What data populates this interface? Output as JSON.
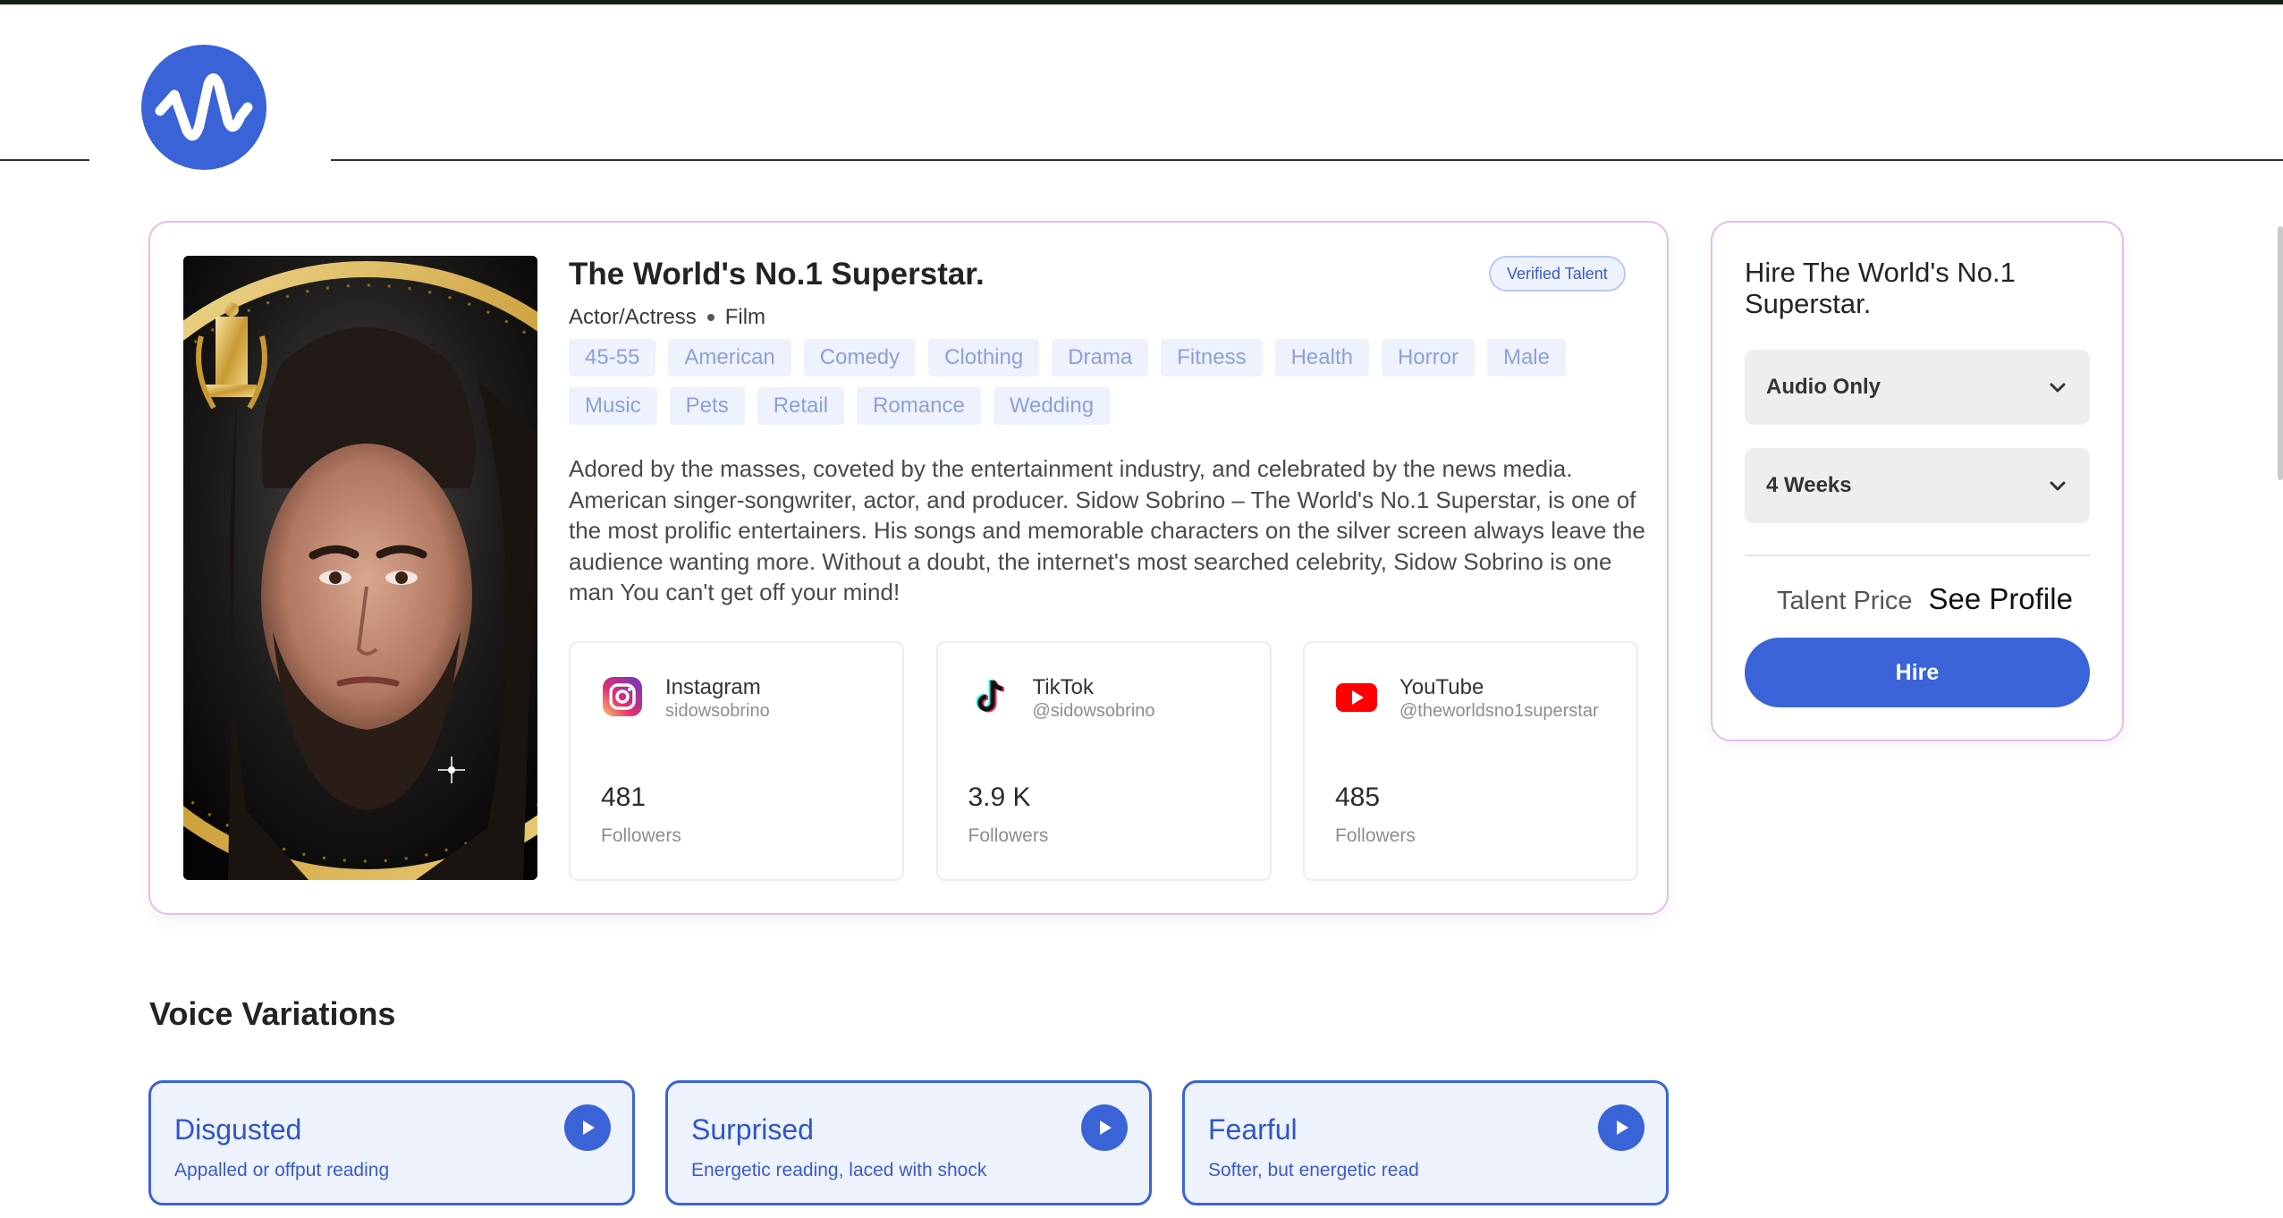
{
  "profile": {
    "title": "The World's No.1 Superstar.",
    "verified_badge": "Verified Talent",
    "role": "Actor/Actress",
    "category": "Film",
    "tags": [
      "45-55",
      "American",
      "Comedy",
      "Clothing",
      "Drama",
      "Fitness",
      "Health",
      "Horror",
      "Male",
      "Music",
      "Pets",
      "Retail",
      "Romance",
      "Wedding"
    ],
    "bio": "Adored by the masses, coveted by the entertainment industry, and celebrated by the news media. American singer-songwriter, actor, and producer. Sidow Sobrino – The World's No.1 Superstar, is one of the most prolific entertainers. His songs and memorable characters on the silver screen always leave the audience wanting more. Without a doubt, the internet's most searched celebrity, Sidow Sobrino is one man You can't get off your mind!"
  },
  "social": [
    {
      "platform": "Instagram",
      "handle": "sidowsobrino",
      "count": "481",
      "label": "Followers",
      "icon": "instagram-icon"
    },
    {
      "platform": "TikTok",
      "handle": "@sidowsobrino",
      "count": "3.9 K",
      "label": "Followers",
      "icon": "tiktok-icon"
    },
    {
      "platform": "YouTube",
      "handle": "@theworldsno1superstar",
      "count": "485",
      "label": "Followers",
      "icon": "youtube-icon"
    }
  ],
  "hire": {
    "title": "Hire The World's No.1 Superstar.",
    "usage_select": "Audio Only",
    "duration_select": "4 Weeks",
    "price_label": "Talent Price",
    "price_link": "See Profile",
    "button": "Hire"
  },
  "voice": {
    "section_title": "Voice Variations",
    "items": [
      {
        "name": "Disgusted",
        "desc": "Appalled or offput reading"
      },
      {
        "name": "Surprised",
        "desc": "Energetic reading, laced with shock"
      },
      {
        "name": "Fearful",
        "desc": "Softer, but energetic read"
      }
    ]
  },
  "colors": {
    "accent": "#3a63d8",
    "card_border": "#e6bde6",
    "tag_bg": "#eef2fd",
    "tag_text": "#8ca0d8"
  }
}
